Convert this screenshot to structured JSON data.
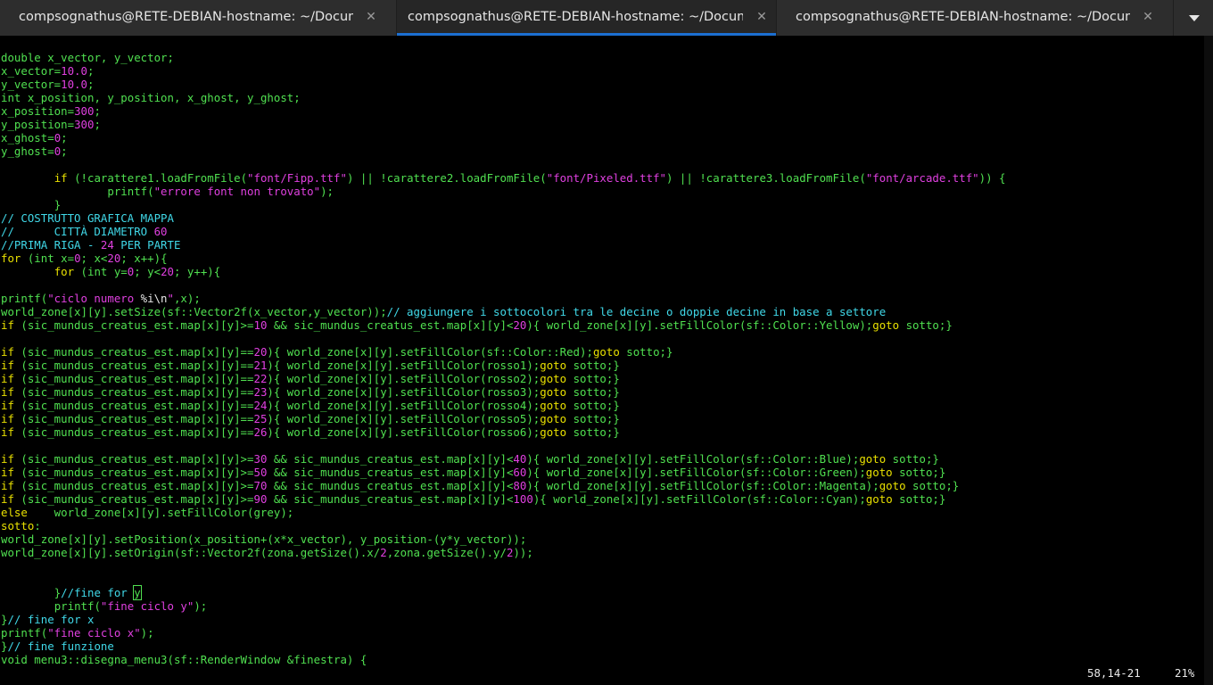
{
  "tabs": [
    {
      "title": "compsognathus@RETE-DEBIAN-hostname: ~/Documenti/aotw/c++/sfml/cfinestra",
      "close": "✕",
      "active": false
    },
    {
      "title": "compsognathus@RETE-DEBIAN-hostname: ~/Documenti/aotw/c++/sfml/cfinestra",
      "close": "✕",
      "active": true
    },
    {
      "title": "compsognathus@RETE-DEBIAN-hostname: ~/Documenti/aotw/c++/sfml/cfinestra",
      "close": "✕",
      "active": false
    }
  ],
  "accent_color": "#1c6fd1",
  "syntax_colors": {
    "keyword": "#e8e000",
    "type": "#50e050",
    "number": "#e040e0",
    "comment": "#40d8e8"
  },
  "code_lines": [
    [
      [
        "typ",
        "double"
      ],
      [
        "wh",
        " "
      ],
      [
        "typ",
        "x_vector, y_vector;"
      ]
    ],
    [
      [
        "typ",
        "x_vector="
      ],
      [
        "num",
        "10.0"
      ],
      [
        "typ",
        ";"
      ]
    ],
    [
      [
        "typ",
        "y_vector="
      ],
      [
        "num",
        "10.0"
      ],
      [
        "typ",
        ";"
      ]
    ],
    [
      [
        "typ",
        "int"
      ],
      [
        "wh",
        " "
      ],
      [
        "typ",
        "x_position, y_position, x_ghost, y_ghost;"
      ]
    ],
    [
      [
        "typ",
        "x_position="
      ],
      [
        "num",
        "300"
      ],
      [
        "typ",
        ";"
      ]
    ],
    [
      [
        "typ",
        "y_position="
      ],
      [
        "num",
        "300"
      ],
      [
        "typ",
        ";"
      ]
    ],
    [
      [
        "typ",
        "x_ghost="
      ],
      [
        "num",
        "0"
      ],
      [
        "typ",
        ";"
      ]
    ],
    [
      [
        "typ",
        "y_ghost="
      ],
      [
        "num",
        "0"
      ],
      [
        "typ",
        ";"
      ]
    ],
    [],
    [
      [
        "wh",
        "        "
      ],
      [
        "kw-y",
        "if"
      ],
      [
        "typ",
        " (!carattere1.loadFromFile("
      ],
      [
        "str",
        "\"font/Fipp.ttf\""
      ],
      [
        "typ",
        ") || !carattere2.loadFromFile("
      ],
      [
        "str",
        "\"font/Pixeled.ttf\""
      ],
      [
        "typ",
        ") || !carattere3.loadFromFile("
      ],
      [
        "str",
        "\"font/arcade.ttf\""
      ],
      [
        "typ",
        ")) {"
      ]
    ],
    [
      [
        "wh",
        "                "
      ],
      [
        "typ",
        "printf("
      ],
      [
        "str",
        "\"errore font non trovato\""
      ],
      [
        "typ",
        ");"
      ]
    ],
    [
      [
        "wh",
        "        "
      ],
      [
        "typ",
        "}"
      ]
    ],
    [
      [
        "cm",
        "// COSTRUTTO GRAFICA MAPPA"
      ]
    ],
    [
      [
        "cm",
        "//      CITTÀ DIAMETRO "
      ],
      [
        "num",
        "60"
      ]
    ],
    [
      [
        "cm",
        "//PRIMA RIGA - "
      ],
      [
        "num",
        "24"
      ],
      [
        "cm",
        " PER PARTE"
      ]
    ],
    [
      [
        "kw-y",
        "for"
      ],
      [
        "typ",
        " (int x="
      ],
      [
        "num",
        "0"
      ],
      [
        "typ",
        "; x<"
      ],
      [
        "num",
        "20"
      ],
      [
        "typ",
        "; x++){"
      ]
    ],
    [
      [
        "wh",
        "        "
      ],
      [
        "kw-y",
        "for"
      ],
      [
        "typ",
        " (int y="
      ],
      [
        "num",
        "0"
      ],
      [
        "typ",
        "; y<"
      ],
      [
        "num",
        "20"
      ],
      [
        "typ",
        "; y++){"
      ]
    ],
    [],
    [
      [
        "typ",
        "printf("
      ],
      [
        "str",
        "\"ciclo numero "
      ],
      [
        "wh",
        "%i\\n"
      ],
      [
        "str",
        "\""
      ],
      [
        "typ",
        ",x);"
      ]
    ],
    [
      [
        "typ",
        "world_zone[x][y].setSize(sf::Vector2f(x_vector,y_vector));"
      ],
      [
        "cm",
        "// aggiungere i sottocolori tra le decine o doppie decine in base a settore"
      ]
    ],
    [
      [
        "kw-y",
        "if"
      ],
      [
        "typ",
        " (sic_mundus_creatus_est.map[x][y]>="
      ],
      [
        "num",
        "10"
      ],
      [
        "typ",
        " && sic_mundus_creatus_est.map[x][y]<"
      ],
      [
        "num",
        "20"
      ],
      [
        "typ",
        "){ world_zone[x][y].setFillColor(sf::Color::Yellow);"
      ],
      [
        "kw-y",
        "goto"
      ],
      [
        "typ",
        " sotto;}"
      ]
    ],
    [],
    [
      [
        "kw-y",
        "if"
      ],
      [
        "typ",
        " (sic_mundus_creatus_est.map[x][y]=="
      ],
      [
        "num",
        "20"
      ],
      [
        "typ",
        "){ world_zone[x][y].setFillColor(sf::Color::Red);"
      ],
      [
        "kw-y",
        "goto"
      ],
      [
        "typ",
        " sotto;}"
      ]
    ],
    [
      [
        "kw-y",
        "if"
      ],
      [
        "typ",
        " (sic_mundus_creatus_est.map[x][y]=="
      ],
      [
        "num",
        "21"
      ],
      [
        "typ",
        "){ world_zone[x][y].setFillColor(rosso1);"
      ],
      [
        "kw-y",
        "goto"
      ],
      [
        "typ",
        " sotto;}"
      ]
    ],
    [
      [
        "kw-y",
        "if"
      ],
      [
        "typ",
        " (sic_mundus_creatus_est.map[x][y]=="
      ],
      [
        "num",
        "22"
      ],
      [
        "typ",
        "){ world_zone[x][y].setFillColor(rosso2);"
      ],
      [
        "kw-y",
        "goto"
      ],
      [
        "typ",
        " sotto;}"
      ]
    ],
    [
      [
        "kw-y",
        "if"
      ],
      [
        "typ",
        " (sic_mundus_creatus_est.map[x][y]=="
      ],
      [
        "num",
        "23"
      ],
      [
        "typ",
        "){ world_zone[x][y].setFillColor(rosso3);"
      ],
      [
        "kw-y",
        "goto"
      ],
      [
        "typ",
        " sotto;}"
      ]
    ],
    [
      [
        "kw-y",
        "if"
      ],
      [
        "typ",
        " (sic_mundus_creatus_est.map[x][y]=="
      ],
      [
        "num",
        "24"
      ],
      [
        "typ",
        "){ world_zone[x][y].setFillColor(rosso4);"
      ],
      [
        "kw-y",
        "goto"
      ],
      [
        "typ",
        " sotto;}"
      ]
    ],
    [
      [
        "kw-y",
        "if"
      ],
      [
        "typ",
        " (sic_mundus_creatus_est.map[x][y]=="
      ],
      [
        "num",
        "25"
      ],
      [
        "typ",
        "){ world_zone[x][y].setFillColor(rosso5);"
      ],
      [
        "kw-y",
        "goto"
      ],
      [
        "typ",
        " sotto;}"
      ]
    ],
    [
      [
        "kw-y",
        "if"
      ],
      [
        "typ",
        " (sic_mundus_creatus_est.map[x][y]=="
      ],
      [
        "num",
        "26"
      ],
      [
        "typ",
        "){ world_zone[x][y].setFillColor(rosso6);"
      ],
      [
        "kw-y",
        "goto"
      ],
      [
        "typ",
        " sotto;}"
      ]
    ],
    [],
    [
      [
        "kw-y",
        "if"
      ],
      [
        "typ",
        " (sic_mundus_creatus_est.map[x][y]>="
      ],
      [
        "num",
        "30"
      ],
      [
        "typ",
        " && sic_mundus_creatus_est.map[x][y]<"
      ],
      [
        "num",
        "40"
      ],
      [
        "typ",
        "){ world_zone[x][y].setFillColor(sf::Color::Blue);"
      ],
      [
        "kw-y",
        "goto"
      ],
      [
        "typ",
        " sotto;}"
      ]
    ],
    [
      [
        "kw-y",
        "if"
      ],
      [
        "typ",
        " (sic_mundus_creatus_est.map[x][y]>="
      ],
      [
        "num",
        "50"
      ],
      [
        "typ",
        " && sic_mundus_creatus_est.map[x][y]<"
      ],
      [
        "num",
        "60"
      ],
      [
        "typ",
        "){ world_zone[x][y].setFillColor(sf::Color::Green);"
      ],
      [
        "kw-y",
        "goto"
      ],
      [
        "typ",
        " sotto;}"
      ]
    ],
    [
      [
        "kw-y",
        "if"
      ],
      [
        "typ",
        " (sic_mundus_creatus_est.map[x][y]>="
      ],
      [
        "num",
        "70"
      ],
      [
        "typ",
        " && sic_mundus_creatus_est.map[x][y]<"
      ],
      [
        "num",
        "80"
      ],
      [
        "typ",
        "){ world_zone[x][y].setFillColor(sf::Color::Magenta);"
      ],
      [
        "kw-y",
        "goto"
      ],
      [
        "typ",
        " sotto;}"
      ]
    ],
    [
      [
        "kw-y",
        "if"
      ],
      [
        "typ",
        " (sic_mundus_creatus_est.map[x][y]>="
      ],
      [
        "num",
        "90"
      ],
      [
        "typ",
        " && sic_mundus_creatus_est.map[x][y]<"
      ],
      [
        "num",
        "100"
      ],
      [
        "typ",
        "){ world_zone[x][y].setFillColor(sf::Color::Cyan);"
      ],
      [
        "kw-y",
        "goto"
      ],
      [
        "typ",
        " sotto;}"
      ]
    ],
    [
      [
        "kw-y",
        "else"
      ],
      [
        "typ",
        "    world_zone[x][y].setFillColor(grey);"
      ]
    ],
    [
      [
        "kw-y",
        "sotto"
      ],
      [
        "typ",
        ":"
      ]
    ],
    [
      [
        "typ",
        "world_zone[x][y].setPosition(x_position+(x*x_vector), y_position-(y*y_vector));"
      ]
    ],
    [
      [
        "typ",
        "world_zone[x][y].setOrigin(sf::Vector2f(zona.getSize().x/"
      ],
      [
        "num",
        "2"
      ],
      [
        "typ",
        ",zona.getSize().y/"
      ],
      [
        "num",
        "2"
      ],
      [
        "typ",
        "));"
      ]
    ],
    [],
    [],
    [
      [
        "wh",
        "        "
      ],
      [
        "typ",
        "}"
      ],
      [
        "cm",
        "//fine for "
      ],
      [
        "cursor",
        "y"
      ]
    ],
    [
      [
        "wh",
        "        "
      ],
      [
        "typ",
        "printf("
      ],
      [
        "str",
        "\"fine ciclo y\""
      ],
      [
        "typ",
        ");"
      ]
    ],
    [
      [
        "typ",
        "}"
      ],
      [
        "cm",
        "// fine for x"
      ]
    ],
    [
      [
        "typ",
        "printf("
      ],
      [
        "str",
        "\"fine ciclo x\""
      ],
      [
        "typ",
        ");"
      ]
    ],
    [
      [
        "typ",
        "}"
      ],
      [
        "cm",
        "// fine funzione"
      ]
    ],
    [
      [
        "typ",
        "void menu3::disegna_menu3(sf::RenderWindow &finestra) {"
      ]
    ]
  ],
  "status": {
    "position": "58,14-21",
    "percent": "21%"
  }
}
